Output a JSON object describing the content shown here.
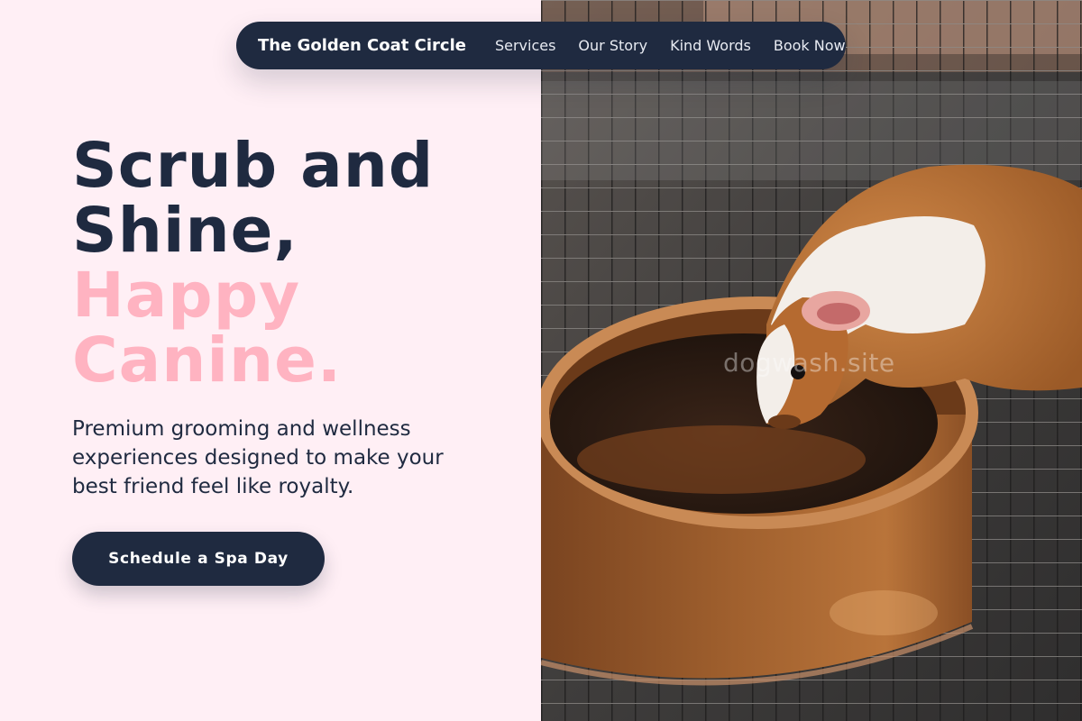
{
  "nav": {
    "brand": "The Golden Coat Circle",
    "links": [
      {
        "label": "Services"
      },
      {
        "label": "Our Story"
      },
      {
        "label": "Kind Words"
      },
      {
        "label": "Book Now"
      }
    ]
  },
  "hero": {
    "headline_line1": "Scrub and",
    "headline_line2": "Shine,",
    "headline_accent_line1": "Happy",
    "headline_accent_line2": "Canine.",
    "subtext": "Premium grooming and wellness experiences designed to make your best friend feel like royalty.",
    "cta_label": "Schedule a Spa Day",
    "image_watermark": "dogwash.site"
  },
  "colors": {
    "navy": "#1f2a40",
    "pink_accent": "#ffb3c1",
    "page_background": "#ffeff5"
  }
}
